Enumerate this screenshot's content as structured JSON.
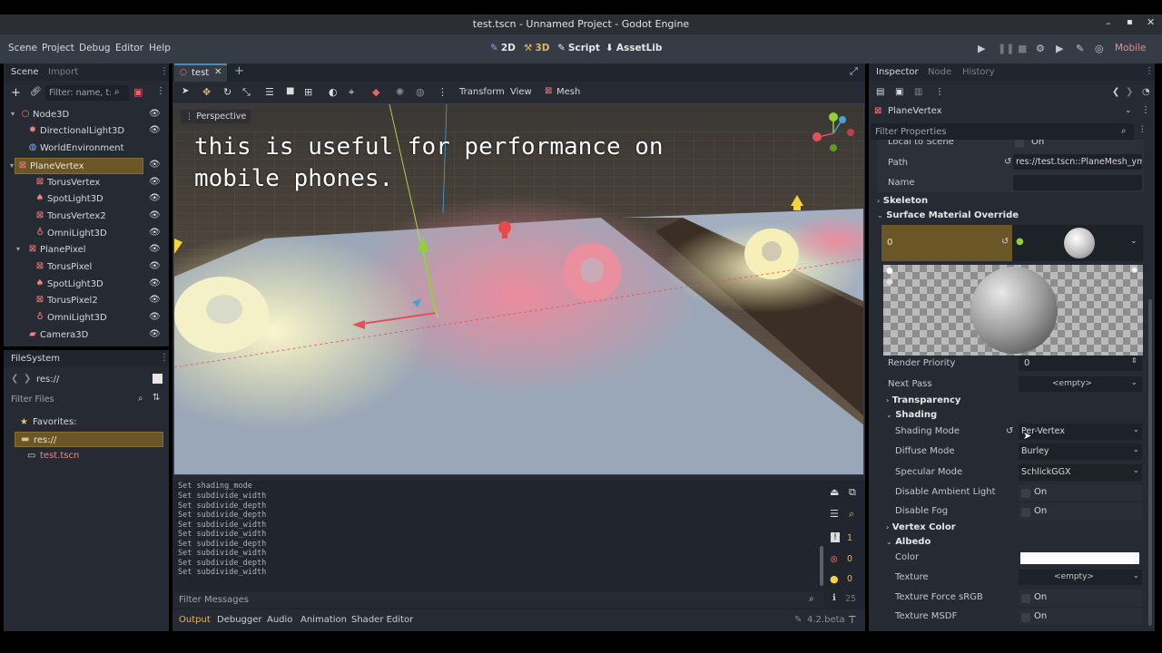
{
  "window": {
    "title": "test.tscn - Unnamed Project - Godot Engine"
  },
  "menu": {
    "items": [
      "Scene",
      "Project",
      "Debug",
      "Editor",
      "Help"
    ]
  },
  "workspaces": [
    {
      "label": "2D",
      "icon": "2d-icon"
    },
    {
      "label": "3D",
      "icon": "3d-icon"
    },
    {
      "label": "Script",
      "icon": "script-icon"
    },
    {
      "label": "AssetLib",
      "icon": "assetlib-icon"
    }
  ],
  "renderer": "Mobile",
  "scene_dock": {
    "tabs": [
      "Scene",
      "Import"
    ],
    "filter_placeholder": "Filter: name, t:t",
    "nodes": [
      {
        "name": "Node3D",
        "icon": "node3d-icon",
        "depth": 0,
        "color": "#fc7f7f"
      },
      {
        "name": "DirectionalLight3D",
        "icon": "directional-light-icon",
        "depth": 1,
        "color": "#fc7f7f"
      },
      {
        "name": "WorldEnvironment",
        "icon": "world-environment-icon",
        "depth": 1,
        "color": "#7aa7ff"
      },
      {
        "name": "PlaneVertex",
        "icon": "mesh-instance-icon",
        "depth": 1,
        "color": "#fc7f7f",
        "selected": true
      },
      {
        "name": "TorusVertex",
        "icon": "mesh-instance-icon",
        "depth": 2,
        "color": "#fc7f7f"
      },
      {
        "name": "SpotLight3D",
        "icon": "spotlight-icon",
        "depth": 2,
        "color": "#fc7f7f"
      },
      {
        "name": "TorusVertex2",
        "icon": "mesh-instance-icon",
        "depth": 2,
        "color": "#fc7f7f"
      },
      {
        "name": "OmniLight3D",
        "icon": "omnilight-icon",
        "depth": 2,
        "color": "#fc7f7f"
      },
      {
        "name": "PlanePixel",
        "icon": "mesh-instance-icon",
        "depth": 1,
        "color": "#fc7f7f"
      },
      {
        "name": "TorusPixel",
        "icon": "mesh-instance-icon",
        "depth": 2,
        "color": "#fc7f7f"
      },
      {
        "name": "SpotLight3D",
        "icon": "spotlight-icon",
        "depth": 2,
        "color": "#fc7f7f"
      },
      {
        "name": "TorusPixel2",
        "icon": "mesh-instance-icon",
        "depth": 2,
        "color": "#fc7f7f"
      },
      {
        "name": "OmniLight3D",
        "icon": "omnilight-icon",
        "depth": 2,
        "color": "#fc7f7f"
      },
      {
        "name": "Camera3D",
        "icon": "camera-icon",
        "depth": 1,
        "color": "#fc7f7f"
      }
    ]
  },
  "filesystem": {
    "title": "FileSystem",
    "path": "res://",
    "filter_placeholder": "Filter Files",
    "favorites_label": "Favorites:",
    "root_label": "res://",
    "file_label": "test.tscn"
  },
  "editor_tabs": {
    "active": "test"
  },
  "toolbar": {
    "transform": "Transform",
    "view": "View",
    "mesh": "Mesh"
  },
  "viewport": {
    "perspective_label": "Perspective",
    "caption_line1": "this is useful for performance on",
    "caption_line2": "mobile phones."
  },
  "output": {
    "lines": [
      "Set shading_mode",
      "Set subdivide_width",
      "Set subdivide_depth",
      "Set subdivide_depth",
      "Set subdivide_width",
      "Set subdivide_width",
      "Set subdivide_depth",
      "Set subdivide_width",
      "Set subdivide_depth",
      "Set subdivide_width"
    ],
    "filter_placeholder": "Filter Messages",
    "counts": {
      "messages": "1",
      "errors": "0",
      "warnings": "0",
      "info": "25"
    }
  },
  "bottom_panel": {
    "tabs": [
      "Output",
      "Debugger",
      "Audio",
      "Animation",
      "Shader Editor"
    ],
    "version": "4.2.beta"
  },
  "inspector": {
    "tabs": [
      "Inspector",
      "Node",
      "History"
    ],
    "node_name": "PlaneVertex",
    "filter_placeholder": "Filter Properties",
    "local_to_scene_label": "Local to Scene",
    "local_to_scene_value": "On",
    "path_label": "Path",
    "path_value": "res://test.tscn::PlaneMesh_ym",
    "name_label": "Name",
    "skeleton_label": "Skeleton",
    "surface_override_label": "Surface Material Override",
    "surface_index": "0",
    "render_priority_label": "Render Priority",
    "render_priority_value": "0",
    "next_pass_label": "Next Pass",
    "next_pass_value": "<empty>",
    "transparency_label": "Transparency",
    "shading_label": "Shading",
    "shading_mode_label": "Shading Mode",
    "shading_mode_value": "Per-Vertex",
    "diffuse_mode_label": "Diffuse Mode",
    "diffuse_mode_value": "Burley",
    "specular_mode_label": "Specular Mode",
    "specular_mode_value": "SchlickGGX",
    "disable_ambient_label": "Disable Ambient Light",
    "disable_ambient_value": "On",
    "disable_fog_label": "Disable Fog",
    "disable_fog_value": "On",
    "vertex_color_label": "Vertex Color",
    "albedo_label": "Albedo",
    "color_label": "Color",
    "albedo_color": "#ffffff",
    "texture_label": "Texture",
    "texture_value": "<empty>",
    "force_srgb_label": "Texture Force sRGB",
    "force_srgb_value": "On",
    "msdf_label": "Texture MSDF",
    "msdf_value": "On"
  },
  "colors": {
    "accent": "#478cbf",
    "selection": "#6b5628",
    "node_red": "#fc7f7f",
    "panel": "#262b33"
  }
}
